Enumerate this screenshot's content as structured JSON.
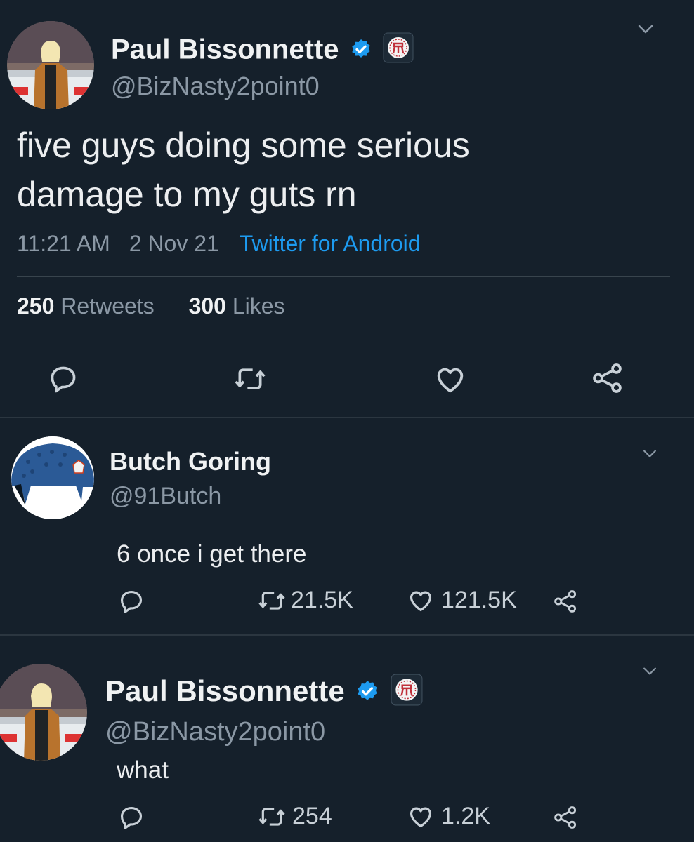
{
  "tweet1": {
    "author_name": "Paul Bissonnette",
    "author_handle": "@BizNasty2point0",
    "text_line1": "five guys doing some serious",
    "text_line2": "damage to my guts rn",
    "time": "11:21 AM",
    "date": "2 Nov 21",
    "source": "Twitter for Android",
    "retweets_count": "250",
    "retweets_label": "Retweets",
    "likes_count": "300",
    "likes_label": "Likes"
  },
  "reply1": {
    "author_name": "Butch Goring",
    "author_handle": "@91Butch",
    "text": "6 once i get there",
    "retweets": "21.5K",
    "likes": "121.5K"
  },
  "reply2": {
    "author_name": "Paul Bissonnette",
    "author_handle": "@BizNasty2point0",
    "text": "what",
    "retweets": "254",
    "likes": "1.2K"
  },
  "icons": [
    "caret-down-icon",
    "verified-badge-icon",
    "barstool-badge-icon",
    "reply-icon",
    "retweet-icon",
    "like-icon",
    "share-icon"
  ],
  "colors": {
    "background": "#15202b",
    "accent": "#1d9bf0",
    "muted": "#8b98a5"
  }
}
